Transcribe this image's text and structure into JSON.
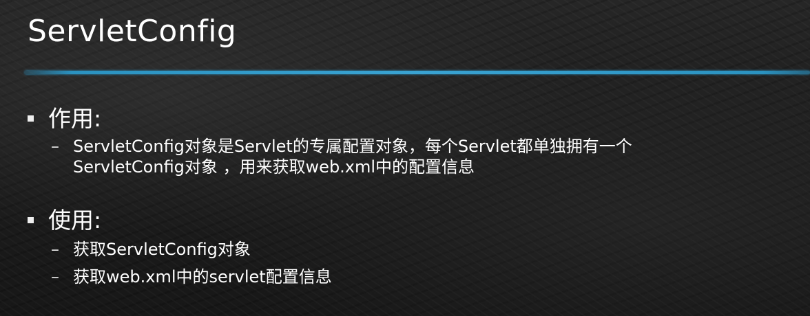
{
  "slide": {
    "title": "ServletConfig",
    "accent_color": "#2b92c0",
    "sections": [
      {
        "heading": "作用:",
        "items": [
          {
            "lines": [
              "ServletConfig对象是Servlet的专属配置对象，每个Servlet都单独拥有一个",
              "ServletConfig对象 ，用来获取web.xml中的配置信息"
            ]
          }
        ]
      },
      {
        "heading": "使用:",
        "items": [
          {
            "lines": [
              "获取ServletConfig对象"
            ]
          },
          {
            "lines": [
              "获取web.xml中的servlet配置信息"
            ]
          }
        ]
      }
    ]
  }
}
